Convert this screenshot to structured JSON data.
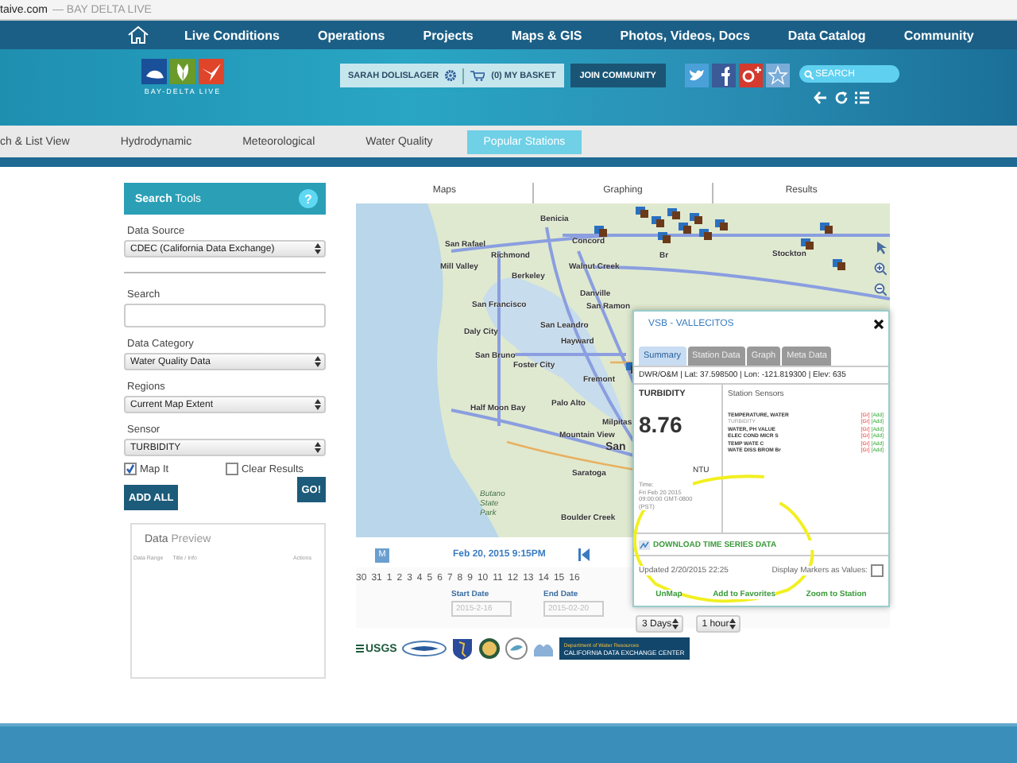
{
  "browser": {
    "address": "taive.com",
    "page_title": "— BAY DELTA LIVE"
  },
  "nav": {
    "items": [
      "Live Conditions",
      "Operations",
      "Projects",
      "Maps & GIS",
      "Photos, Videos, Docs",
      "Data Catalog",
      "Community"
    ]
  },
  "header": {
    "logo_text": "BAY-DELTA LIVE",
    "user": "SARAH DOLISLAGER",
    "basket": "(0) MY BASKET",
    "join": "JOIN COMMUNITY",
    "search_placeholder": "SEARCH"
  },
  "tabs": [
    {
      "label": "ch & List View",
      "selected": false
    },
    {
      "label": "Hydrodynamic",
      "selected": false
    },
    {
      "label": "Meteorological",
      "selected": false
    },
    {
      "label": "Water Quality",
      "selected": false
    },
    {
      "label": "Popular Stations",
      "selected": true
    }
  ],
  "search_tools": {
    "title": "**Search** Tools",
    "help": "?",
    "fields": [
      {
        "kind": "select",
        "label": "Data Source",
        "value": "CDEC (California Data Exchange)"
      },
      {
        "kind": "text",
        "label": "Search"
      },
      {
        "kind": "select",
        "label": "Data Category",
        "value": "Water Quality Data"
      },
      {
        "kind": "select",
        "label": "Regions",
        "value": "Current Map Extent"
      },
      {
        "kind": "select",
        "label": "Sensor",
        "value": "TURBIDITY"
      }
    ],
    "map_it": {
      "label": "Map It",
      "checked": true
    },
    "clear_results": {
      "label": "Clear Results",
      "checked": false
    },
    "go": "GO!",
    "add_all": "ADD ALL"
  },
  "preview": {
    "title": "**Data** Preview",
    "columns": [
      "Data Range",
      "Title / Info",
      "Actions"
    ]
  },
  "map_tabs": [
    "Maps",
    "Graphing",
    "Results"
  ],
  "map": {
    "labels": [
      "Benicia",
      "Concord",
      "Richmond",
      "San Rafael",
      "Mill Valley",
      "Berkeley",
      "Walnut Creek",
      "Danville",
      "San Ramon",
      "San Francisco",
      "San Leandro",
      "Daly City",
      "Hayward",
      "San Bruno",
      "Foster City",
      "Fremont",
      "Half Moon Bay",
      "Palo Alto",
      "Milpitas",
      "Mountain View",
      "San",
      "Saratoga",
      "Butano State Park",
      "Boulder Creek",
      "Br",
      "Stockton"
    ]
  },
  "timeline": {
    "mode": "M",
    "datetime": "Feb 20, 2015 9:15PM",
    "days": [
      "30",
      "31",
      "1",
      "2",
      "3",
      "4",
      "5",
      "6",
      "7",
      "8",
      "9",
      "10",
      "11",
      "12",
      "13",
      "14",
      "15",
      "16"
    ],
    "start_label": "Start Date",
    "start": "2015-2-16",
    "end_label": "End Date",
    "end": "2015-02-20",
    "range": "3 Days",
    "interval": "1 hour"
  },
  "logos": {
    "usgs": "USGS",
    "dwr_top": "Department of Water Resources",
    "dwr_bottom": "CALIFORNIA DATA EXCHANGE CENTER"
  },
  "popup": {
    "title": "VSB - VALLECITOS",
    "tabs": [
      {
        "label": "Summary",
        "selected": true
      },
      {
        "label": "Station Data",
        "selected": false
      },
      {
        "label": "Graph",
        "selected": false
      },
      {
        "label": "Meta Data",
        "selected": false
      }
    ],
    "meta": "DWR/O&M | Lat: 37.598500 | Lon: -121.819300 | Elev: 635",
    "sensor_name": "TURBIDITY",
    "value": "8.76",
    "unit": "NTU",
    "time": [
      "Time:",
      "Fri Feb 20 2015",
      "09:00:00 GMT-0800",
      "(PST)"
    ],
    "sensors_title": "Station Sensors",
    "sensors": [
      {
        "name": "TEMPERATURE, WATER",
        "selected": false,
        "graph": "[Gr]",
        "add": "[Add]"
      },
      {
        "name": "TURBIDITY",
        "selected": true,
        "graph": "[Gr]",
        "add": "[Add]"
      },
      {
        "name": "WATER, PH VALUE",
        "selected": false,
        "graph": "[Gr]",
        "add": "[Add]"
      },
      {
        "name": "ELEC COND MICR S",
        "selected": false,
        "graph": "[Gr]",
        "add": "[Add]"
      },
      {
        "name": "TEMP WATE C",
        "selected": false,
        "graph": "[Gr]",
        "add": "[Add]"
      },
      {
        "name": "WATE DISS BROM Br",
        "selected": false,
        "graph": "[Gr]",
        "add": "[Add]"
      }
    ],
    "download": "DOWNLOAD TIME SERIES DATA",
    "updated": "Updated 2/20/2015 22:25",
    "markers_label": "Display Markers as Values:",
    "markers_checked": false,
    "actions": [
      "UnMap",
      "Add to Favorites",
      "Zoom to Station"
    ]
  }
}
